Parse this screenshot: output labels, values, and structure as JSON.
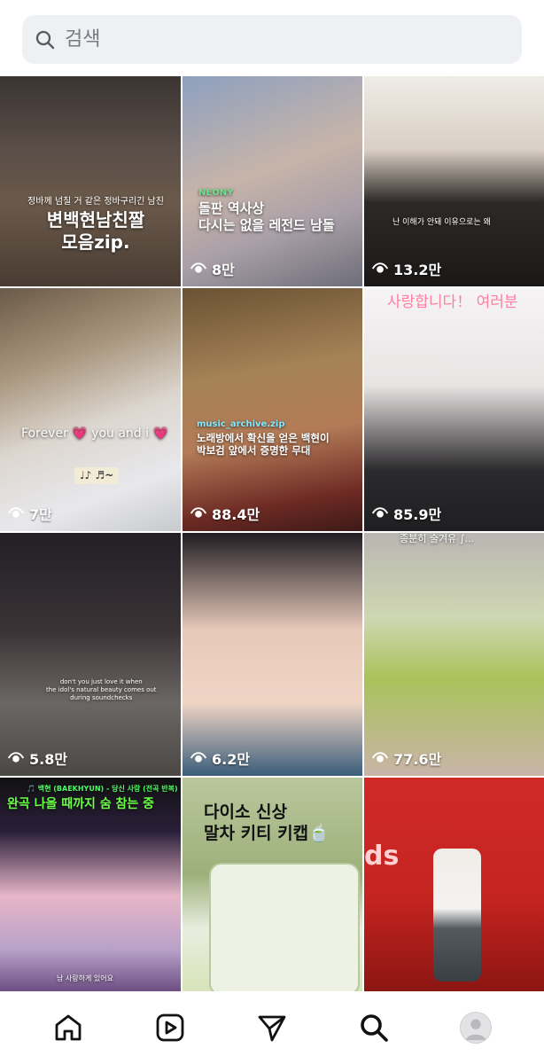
{
  "search": {
    "placeholder": "검색"
  },
  "tiles": [
    {
      "views": "",
      "caption_small": "정바께 넘칠 거 같은 정바구리긴 남친",
      "caption_big": "변백현남친짤\n모음zip."
    },
    {
      "views": "8만",
      "brand": "NEONY",
      "caption": "돌판 역사상\n다시는 없을 레전드 남돌"
    },
    {
      "views": "13.2만",
      "caption_small": "난 이해가 안돼 이유으로는 왜"
    },
    {
      "views": "7만",
      "caption": "Forever 💗 you and i 💗",
      "sticker": "♩♪ ♬~"
    },
    {
      "views": "88.4만",
      "tag": "music_archive.zip",
      "caption": "노래방에서 확신을 얻은 백현이\n박보검 앞에서 증명한 무대"
    },
    {
      "views": "85.9만",
      "caption": "사랑합니다！ 여러분"
    },
    {
      "views": "5.8만",
      "caption_small": "don't you just love it when\nthe idol's natural beauty comes out\nduring soundchecks"
    },
    {
      "views": "6.2만"
    },
    {
      "views": "77.6만",
      "caption_small": "종분히 술겨유 ∫..."
    },
    {
      "views": "",
      "caption_small": "🎵 백현 (BAEKHYUN) - 당신 사랑 (전곡 반복)",
      "caption": "완곡 나올 때까지 숨 참는 중",
      "caption_small2": "남 사랑하게 있어요"
    },
    {
      "views": "",
      "caption": "다이소 신상\n말차 키티 키캡🍵"
    },
    {
      "views": "",
      "caption": "ds"
    }
  ],
  "nav": {
    "items": [
      "home-icon",
      "reels-icon",
      "send-icon",
      "search-icon",
      "profile-avatar"
    ],
    "active": "search-icon"
  },
  "colors": {
    "search_bg": "#eef0f3",
    "placeholder": "#777b80",
    "text": "#111111"
  }
}
